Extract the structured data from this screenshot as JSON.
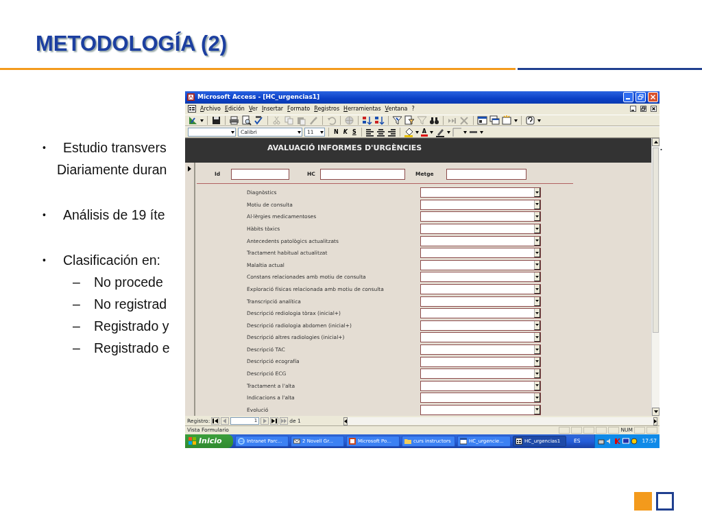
{
  "slide": {
    "title": "METODOLOGÍA (2)",
    "lines": [
      {
        "kind": "bullet",
        "marker": "•",
        "text": "Estudio transvers"
      },
      {
        "kind": "continuation",
        "text": "Diariamente duran"
      },
      {
        "kind": "bullet",
        "marker": "•",
        "text": "Análisis de 19 íte"
      },
      {
        "kind": "bullet",
        "marker": "•",
        "text": "Clasificación en:"
      },
      {
        "kind": "dash",
        "marker": "–",
        "text": "No procede"
      },
      {
        "kind": "dash",
        "marker": "–",
        "text": "No registrad"
      },
      {
        "kind": "dash",
        "marker": "–",
        "text": "Registrado y"
      },
      {
        "kind": "dash",
        "marker": "–",
        "text": "Registrado e"
      }
    ],
    "stray_mark": "."
  },
  "window": {
    "title": "Microsoft Access - [HC_urgencias1]",
    "menu": [
      "Archivo",
      "Edición",
      "Ver",
      "Insertar",
      "Formato",
      "Registros",
      "Herramientas",
      "Ventana",
      "?"
    ],
    "font": "Calibri",
    "font_size": "11",
    "format_buttons": [
      "N",
      "K",
      "S"
    ],
    "font_color_letter": "A",
    "form": {
      "header": "AVALUACIÓ INFORMES D'URGÈNCIES",
      "fields": [
        {
          "label": "Id"
        },
        {
          "label": "HC"
        },
        {
          "label": "Metge"
        }
      ],
      "items": [
        "Diagnòstics",
        "Motiu de consulta",
        "Al·lèrgies medicamentoses",
        "Hàbits tòxics",
        "Antecedents patològics actualitzats",
        "Tractament habitual actualitzat",
        "Malaltia actual",
        "Constans relacionades amb motiu de consulta",
        "Exploració físicas relacionada amb motiu de consulta",
        "Transcripció analítica",
        "Descripció rediologia tòrax (inicial+)",
        "Descripció radiologia abdomen (inicial+)",
        "Descripció altres radiologies (inicial+)",
        "Descripció TAC",
        "Descripció ecografía",
        "Descripció ECG",
        "Tractament a l'alta",
        "Indicacions a l'alta",
        "Evolució"
      ]
    },
    "record_nav": {
      "label": "Registro:",
      "current": "1",
      "total": "de 1"
    },
    "status_bar": {
      "text": "Vista Formulario",
      "indicator": "NUM"
    }
  },
  "taskbar": {
    "start": "Inicio",
    "tasks": [
      {
        "label": "Intranet Parc...",
        "selected": false
      },
      {
        "label": "2 Novell Gr...",
        "selected": false
      },
      {
        "label": "Microsoft Po...",
        "selected": false
      },
      {
        "label": "curs instructors",
        "selected": false
      },
      {
        "label": "HC_urgencie...",
        "selected": false
      },
      {
        "label": "HC_urgencias1",
        "selected": true
      }
    ],
    "language": "ES",
    "clock": "17:57"
  }
}
